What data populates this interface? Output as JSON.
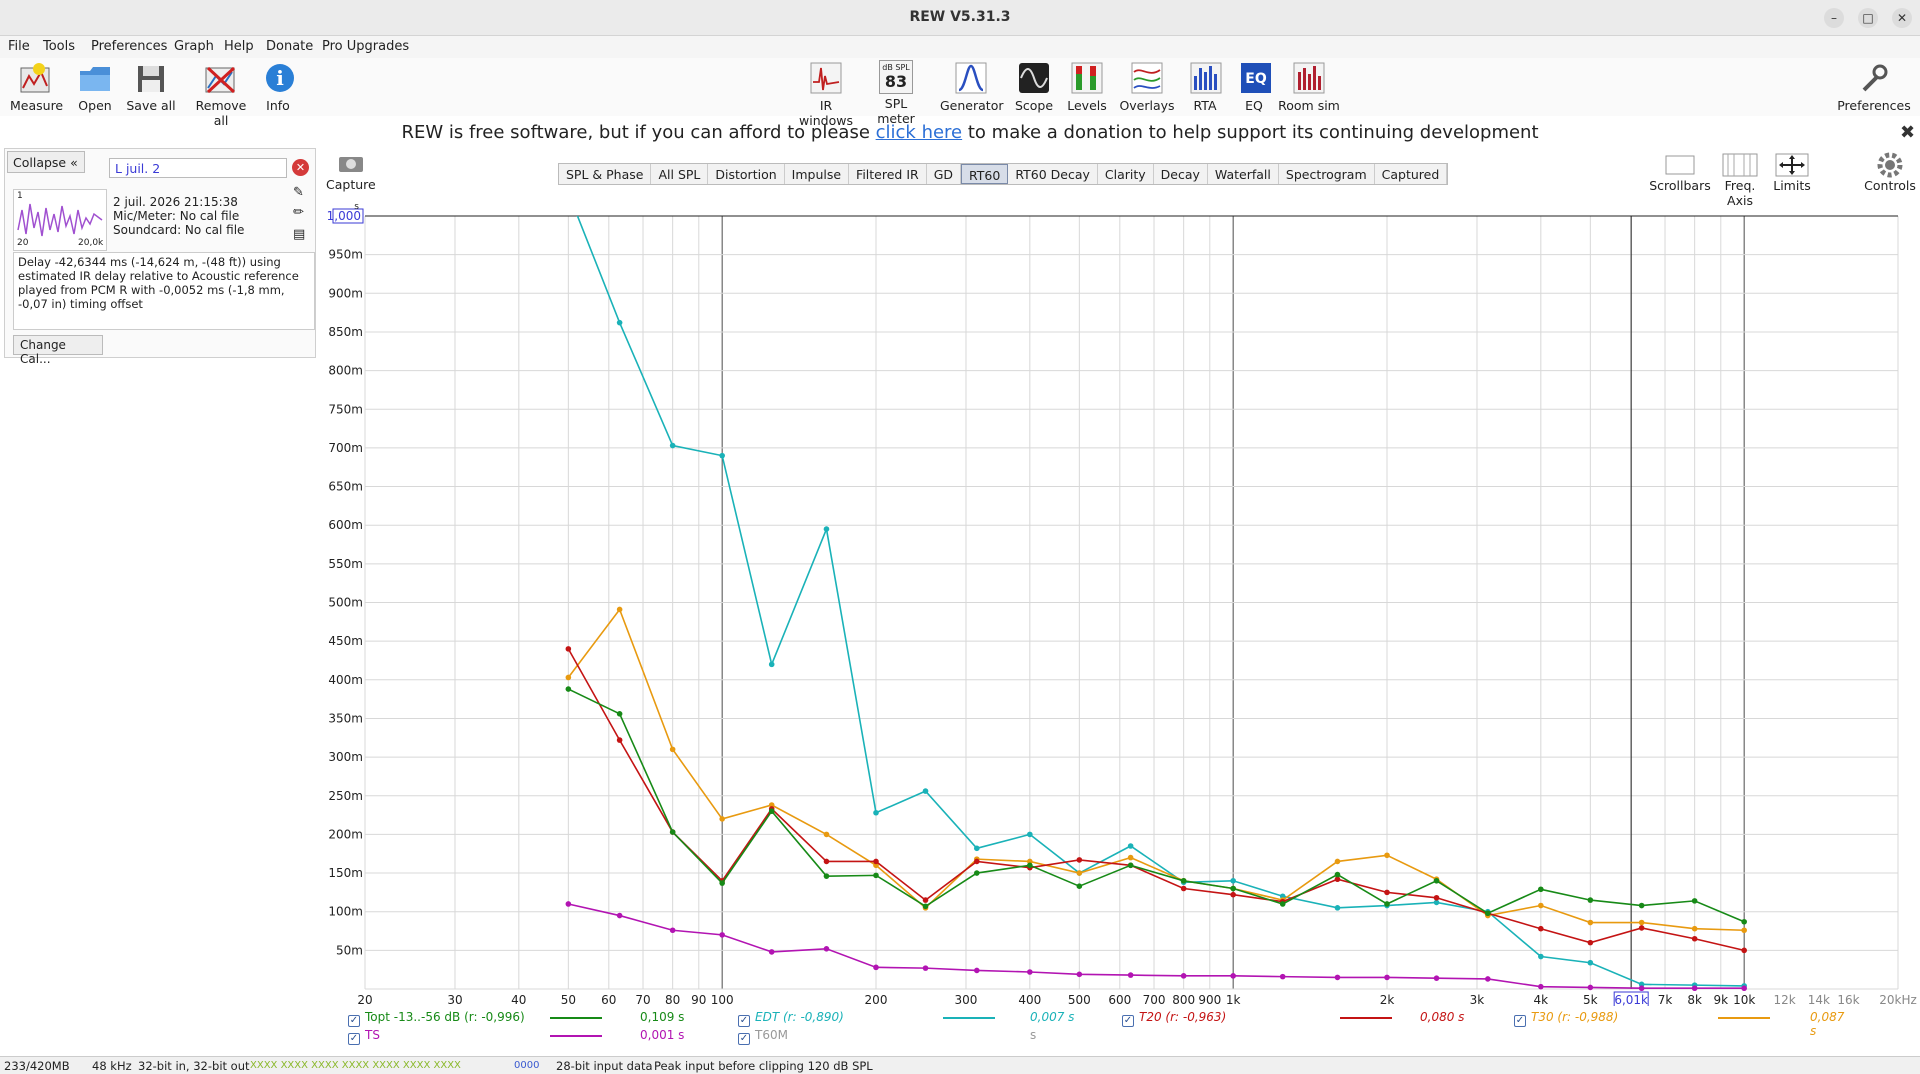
{
  "window": {
    "title": "REW V5.31.3",
    "controls": [
      "minimize-icon",
      "maximize-icon",
      "close-icon"
    ]
  },
  "menu": [
    "File",
    "Tools",
    "Preferences",
    "Graph",
    "Help",
    "Donate",
    "Pro Upgrades"
  ],
  "toolbar": {
    "left": [
      "Measure",
      "Open",
      "Save all",
      "Remove all",
      "Info"
    ],
    "center": [
      "IR windows",
      "SPL meter",
      "Generator",
      "Scope",
      "Levels",
      "Overlays",
      "RTA",
      "EQ",
      "Room sim"
    ],
    "right": "Preferences",
    "spl_badge_top": "dB SPL",
    "spl_badge_value": "83"
  },
  "banner": {
    "before": "REW is free software, but if you can afford to please ",
    "link": "click here",
    "after": " to make a donation to help support its continuing development"
  },
  "panel": {
    "collapse": "Collapse",
    "name": "L juil. 2",
    "index": "1",
    "date": "2 juil. 2026 21:15:38",
    "mic": "Mic/Meter: No cal file",
    "soundcard": "Soundcard: No cal file",
    "thumb_min": "20",
    "thumb_max": "20,0k",
    "delay": "Delay -42,6344 ms (-14,624 m, -(48 ft)) using estimated IR delay relative to Acoustic reference played from PCM R with -0,0052 ms (-1,8 mm, -0,07 in) timing offset",
    "change_cal": "Change Cal..."
  },
  "capture": "Capture",
  "tabs": [
    "SPL & Phase",
    "All SPL",
    "Distortion",
    "Impulse",
    "Filtered IR",
    "GD",
    "RT60",
    "RT60 Decay",
    "Clarity",
    "Decay",
    "Waterfall",
    "Spectrogram",
    "Captured"
  ],
  "active_tab": "RT60",
  "right_controls": [
    "Scrollbars",
    "Freq. Axis",
    "Limits",
    "Controls"
  ],
  "chart_data": {
    "type": "line",
    "ylabel": "s",
    "xscale": "log",
    "xlim": [
      20,
      20000
    ],
    "ylim": [
      0,
      1.0
    ],
    "y_top_label": "1,000",
    "y_ticks": [
      "50m",
      "100m",
      "150m",
      "200m",
      "250m",
      "300m",
      "350m",
      "400m",
      "450m",
      "500m",
      "550m",
      "600m",
      "650m",
      "700m",
      "750m",
      "800m",
      "850m",
      "900m",
      "950m"
    ],
    "x_ticks": [
      {
        "v": 20,
        "t": "20"
      },
      {
        "v": 30,
        "t": "30"
      },
      {
        "v": 40,
        "t": "40"
      },
      {
        "v": 50,
        "t": "50"
      },
      {
        "v": 60,
        "t": "60"
      },
      {
        "v": 70,
        "t": "70"
      },
      {
        "v": 80,
        "t": "80"
      },
      {
        "v": 90,
        "t": "90"
      },
      {
        "v": 100,
        "t": "100"
      },
      {
        "v": 200,
        "t": "200"
      },
      {
        "v": 300,
        "t": "300"
      },
      {
        "v": 400,
        "t": "400"
      },
      {
        "v": 500,
        "t": "500"
      },
      {
        "v": 600,
        "t": "600"
      },
      {
        "v": 700,
        "t": "700"
      },
      {
        "v": 800,
        "t": "800"
      },
      {
        "v": 900,
        "t": "900"
      },
      {
        "v": 1000,
        "t": "1k"
      },
      {
        "v": 2000,
        "t": "2k"
      },
      {
        "v": 3000,
        "t": "3k"
      },
      {
        "v": 4000,
        "t": "4k"
      },
      {
        "v": 5000,
        "t": "5k"
      },
      {
        "v": 7000,
        "t": "7k"
      },
      {
        "v": 8000,
        "t": "8k"
      },
      {
        "v": 9000,
        "t": "9k"
      },
      {
        "v": 10000,
        "t": "10k"
      },
      {
        "v": 12000,
        "t": "12k"
      },
      {
        "v": 14000,
        "t": "14k"
      },
      {
        "v": 16000,
        "t": "16k"
      },
      {
        "v": 20000,
        "t": "20kHz"
      }
    ],
    "cursor": {
      "x": 6010,
      "label": "6,01k"
    },
    "x": [
      50,
      63,
      80,
      100,
      125,
      160,
      200,
      250,
      315,
      400,
      500,
      630,
      800,
      1000,
      1250,
      1600,
      2000,
      2500,
      3150,
      4000,
      5000,
      6300,
      8000,
      10000
    ],
    "series": [
      {
        "name": "EDT",
        "color": "#1ab2b8",
        "values": [
          1.03,
          0.862,
          0.703,
          0.69,
          0.42,
          0.595,
          0.228,
          0.256,
          0.182,
          0.2,
          0.15,
          0.185,
          0.138,
          0.14,
          0.12,
          0.105,
          0.108,
          0.112,
          0.1,
          0.042,
          0.034,
          0.006,
          0.005,
          0.004
        ]
      },
      {
        "name": "T30",
        "color": "#e89a10",
        "values": [
          0.403,
          0.491,
          0.31,
          0.22,
          0.238,
          0.2,
          0.16,
          0.105,
          0.168,
          0.165,
          0.15,
          0.17,
          0.14,
          0.13,
          0.115,
          0.165,
          0.173,
          0.142,
          0.095,
          0.108,
          0.086,
          0.086,
          0.078,
          0.076
        ]
      },
      {
        "name": "T20",
        "color": "#c41414",
        "values": [
          0.44,
          0.322,
          0.203,
          0.14,
          0.233,
          0.165,
          0.165,
          0.115,
          0.165,
          0.157,
          0.167,
          0.16,
          0.13,
          0.122,
          0.113,
          0.142,
          0.125,
          0.118,
          0.098,
          0.078,
          0.06,
          0.079,
          0.065,
          0.05
        ]
      },
      {
        "name": "Topt",
        "color": "#178a17",
        "values": [
          0.388,
          0.356,
          0.203,
          0.137,
          0.23,
          0.146,
          0.147,
          0.107,
          0.15,
          0.16,
          0.133,
          0.16,
          0.14,
          0.13,
          0.11,
          0.148,
          0.11,
          0.14,
          0.098,
          0.129,
          0.115,
          0.108,
          0.114,
          0.087
        ]
      },
      {
        "name": "TS",
        "color": "#b214b2",
        "values": [
          0.11,
          0.095,
          0.076,
          0.07,
          0.048,
          0.052,
          0.028,
          0.027,
          0.024,
          0.022,
          0.019,
          0.018,
          0.017,
          0.017,
          0.016,
          0.015,
          0.015,
          0.014,
          0.013,
          0.003,
          0.002,
          0.001,
          0.001,
          0.001
        ]
      }
    ]
  },
  "legend": [
    {
      "label": "Topt -13..-56 dB (r: -0,996)",
      "value": "0,109 s",
      "color": "#178a17",
      "checked": true
    },
    {
      "label": "EDT (r: -0,890)",
      "value": "0,007 s",
      "color": "#1ab2b8",
      "checked": true
    },
    {
      "label": "T20 (r: -0,963)",
      "value": "0,080 s",
      "color": "#c41414",
      "checked": true
    },
    {
      "label": "T30 (r: -0,988)",
      "value": "0,087 s",
      "color": "#e89a10",
      "checked": true
    },
    {
      "label": "TS",
      "value": "0,001 s",
      "color": "#b214b2",
      "checked": true
    },
    {
      "label": "T60M",
      "value": "s",
      "color": "#999999",
      "checked": true
    }
  ],
  "status": {
    "memory": "233/420MB",
    "rate": "48 kHz",
    "bits": "32-bit in, 32-bit out",
    "levels": "XXXX XXXX  XXXX XXXX  XXXX XXXX  XXXX",
    "levels2": "0000",
    "input": "28-bit input data",
    "peak": "Peak input before clipping 120 dB SPL"
  }
}
